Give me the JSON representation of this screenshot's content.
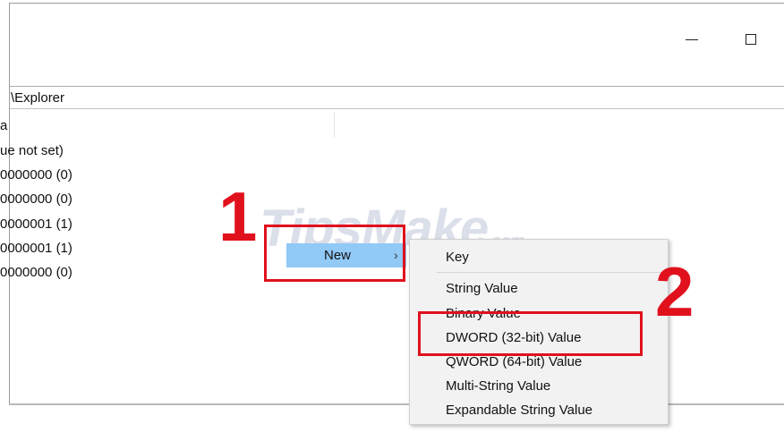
{
  "address": {
    "path": "\\Explorer"
  },
  "values": [
    {
      "text": "a"
    },
    {
      "text": "ue not set)"
    },
    {
      "text": "0000000 (0)"
    },
    {
      "text": "0000000 (0)"
    },
    {
      "text": "0000001 (1)"
    },
    {
      "text": "0000001 (1)"
    },
    {
      "text": "0000000 (0)"
    }
  ],
  "context_menu": {
    "new_label": "New",
    "chevron": "›"
  },
  "submenu": {
    "items": [
      {
        "label": "Key"
      },
      {
        "label": "String Value"
      },
      {
        "label": "Binary Value"
      },
      {
        "label": "DWORD (32-bit) Value"
      },
      {
        "label": "QWORD (64-bit) Value"
      },
      {
        "label": "Multi-String Value"
      },
      {
        "label": "Expandable String Value"
      }
    ]
  },
  "annotations": {
    "step1": "1",
    "step2": "2",
    "highlight_color": "#e0111d"
  },
  "watermark": {
    "text": "TipsMake",
    "suffix": ".com"
  },
  "colors": {
    "menu_highlight": "#91c9f7",
    "submenu_bg": "#f2f2f2"
  }
}
